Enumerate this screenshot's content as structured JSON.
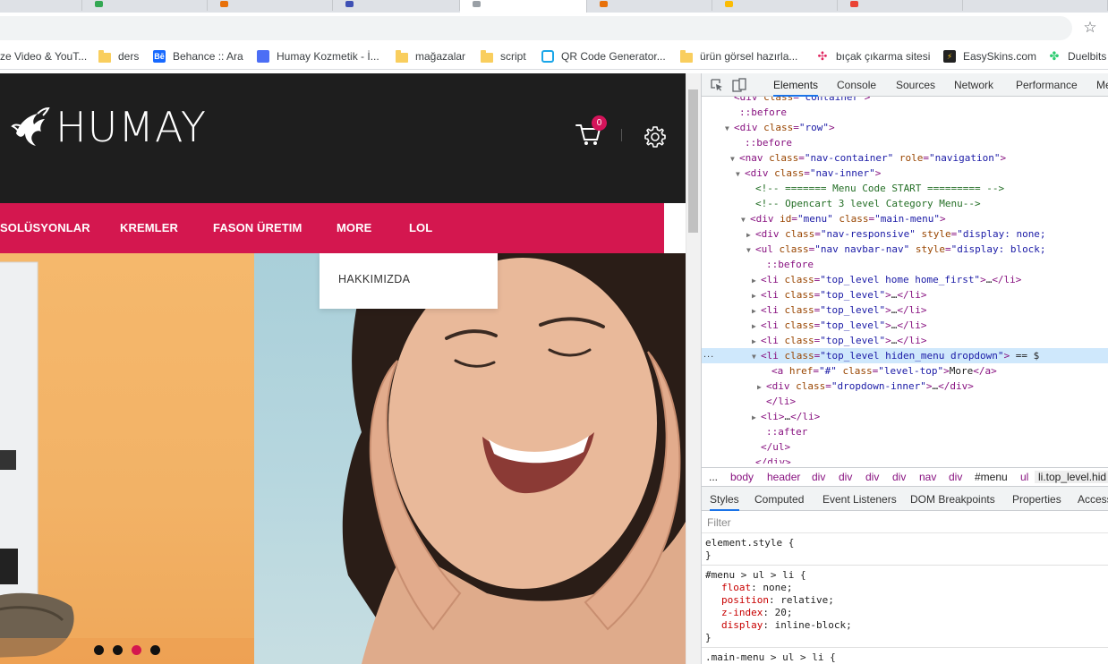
{
  "bookmarks": [
    {
      "label": "ze Video & YouT...",
      "icon": "none"
    },
    {
      "label": "ders",
      "icon": "folder-icon"
    },
    {
      "label": "Behance :: Ara",
      "icon": "behance-icon"
    },
    {
      "label": "Humay Kozmetik - İ...",
      "icon": "site-icon"
    },
    {
      "label": "mağazalar",
      "icon": "folder-icon"
    },
    {
      "label": "script",
      "icon": "folder-icon"
    },
    {
      "label": "QR Code Generator...",
      "icon": "qr-icon"
    },
    {
      "label": "ürün görsel hazırla...",
      "icon": "folder-icon"
    },
    {
      "label": "bıçak çıkarma sitesi",
      "icon": "scissor-icon"
    },
    {
      "label": "EasySkins.com",
      "icon": "easyskins-icon"
    },
    {
      "label": "Duelbits",
      "icon": "duelbits-icon"
    }
  ],
  "site": {
    "logo": "HUMAY",
    "cart_count": "0",
    "nav": [
      "SOLÜSYONLAR",
      "KREMLER",
      "FASON ÜRETIM",
      "MORE",
      "LOL"
    ],
    "dropdown_item": "HAKKIMIZDA"
  },
  "devtools": {
    "tabs": [
      "Elements",
      "Console",
      "Sources",
      "Network",
      "Performance",
      "Me"
    ],
    "dom_lines": [
      {
        "indent": 6,
        "tri": "",
        "html": "<span class='tok-tag'>&lt;div</span> <span class='tok-attr'>class</span>=<span class='tok-val'>\"container\"</span><span class='tok-tag'>&gt;</span>"
      },
      {
        "indent": 7,
        "tri": "",
        "html": "<span class='tok-pseudo'>::before</span>"
      },
      {
        "indent": 6,
        "tri": "▼",
        "html": "<span class='tok-tag'>&lt;div</span> <span class='tok-attr'>class</span>=<span class='tok-val'>\"row\"</span><span class='tok-tag'>&gt;</span>"
      },
      {
        "indent": 8,
        "tri": "",
        "html": "<span class='tok-pseudo'>::before</span>"
      },
      {
        "indent": 7,
        "tri": "▼",
        "html": "<span class='tok-tag'>&lt;nav</span> <span class='tok-attr'>class</span>=<span class='tok-val'>\"nav-container\"</span> <span class='tok-attr'>role</span>=<span class='tok-val'>\"navigation\"</span><span class='tok-tag'>&gt;</span>"
      },
      {
        "indent": 8,
        "tri": "▼",
        "html": "<span class='tok-tag'>&lt;div</span> <span class='tok-attr'>class</span>=<span class='tok-val'>\"nav-inner\"</span><span class='tok-tag'>&gt;</span>"
      },
      {
        "indent": 10,
        "tri": "",
        "html": "<span class='tok-cmt'>&lt;!-- ======= Menu Code START ========= --&gt;</span>"
      },
      {
        "indent": 10,
        "tri": "",
        "html": "<span class='tok-cmt'>&lt;!-- Opencart 3 level Category Menu--&gt;</span>"
      },
      {
        "indent": 9,
        "tri": "▼",
        "html": "<span class='tok-tag'>&lt;div</span> <span class='tok-attr'>id</span>=<span class='tok-val'>\"menu\"</span> <span class='tok-attr'>class</span>=<span class='tok-val'>\"main-menu\"</span><span class='tok-tag'>&gt;</span>"
      },
      {
        "indent": 10,
        "tri": "▶",
        "html": "<span class='tok-tag'>&lt;div</span> <span class='tok-attr'>class</span>=<span class='tok-val'>\"nav-responsive\"</span> <span class='tok-attr'>style</span>=<span class='tok-val'>\"display: none;</span>"
      },
      {
        "indent": 10,
        "tri": "▼",
        "html": "<span class='tok-tag'>&lt;ul</span> <span class='tok-attr'>class</span>=<span class='tok-val'>\"nav navbar-nav\"</span> <span class='tok-attr'>style</span>=<span class='tok-val'>\"display: block;</span>"
      },
      {
        "indent": 12,
        "tri": "",
        "html": "<span class='tok-pseudo'>::before</span>"
      },
      {
        "indent": 11,
        "tri": "▶",
        "html": "<span class='tok-tag'>&lt;li</span> <span class='tok-attr'>class</span>=<span class='tok-val'>\"top_level home home_first\"</span><span class='tok-tag'>&gt;</span><span class='tok-text'>…</span><span class='tok-tag'>&lt;/li&gt;</span>"
      },
      {
        "indent": 11,
        "tri": "▶",
        "html": "<span class='tok-tag'>&lt;li</span> <span class='tok-attr'>class</span>=<span class='tok-val'>\"top_level\"</span><span class='tok-tag'>&gt;</span><span class='tok-text'>…</span><span class='tok-tag'>&lt;/li&gt;</span>"
      },
      {
        "indent": 11,
        "tri": "▶",
        "html": "<span class='tok-tag'>&lt;li</span> <span class='tok-attr'>class</span>=<span class='tok-val'>\"top_level\"</span><span class='tok-tag'>&gt;</span><span class='tok-text'>…</span><span class='tok-tag'>&lt;/li&gt;</span>"
      },
      {
        "indent": 11,
        "tri": "▶",
        "html": "<span class='tok-tag'>&lt;li</span> <span class='tok-attr'>class</span>=<span class='tok-val'>\"top_level\"</span><span class='tok-tag'>&gt;</span><span class='tok-text'>…</span><span class='tok-tag'>&lt;/li&gt;</span>"
      },
      {
        "indent": 11,
        "tri": "▶",
        "html": "<span class='tok-tag'>&lt;li</span> <span class='tok-attr'>class</span>=<span class='tok-val'>\"top_level\"</span><span class='tok-tag'>&gt;</span><span class='tok-text'>…</span><span class='tok-tag'>&lt;/li&gt;</span>"
      },
      {
        "indent": 11,
        "tri": "▼",
        "sel": true,
        "html": "<span class='tok-tag'>&lt;li</span> <span class='tok-attr'>class</span>=<span class='tok-val'>\"top_level hiden_menu dropdown\"</span><span class='tok-tag'>&gt;</span><span class='tok-text'> == $</span>"
      },
      {
        "indent": 13,
        "tri": "",
        "html": "<span class='tok-tag'>&lt;a</span> <span class='tok-attr'>href</span>=<span class='tok-val'>\"#\"</span> <span class='tok-attr'>class</span>=<span class='tok-val'>\"level-top\"</span><span class='tok-tag'>&gt;</span><span class='tok-text'>More</span><span class='tok-tag'>&lt;/a&gt;</span>"
      },
      {
        "indent": 12,
        "tri": "▶",
        "html": "<span class='tok-tag'>&lt;div</span> <span class='tok-attr'>class</span>=<span class='tok-val'>\"dropdown-inner\"</span><span class='tok-tag'>&gt;</span><span class='tok-text'>…</span><span class='tok-tag'>&lt;/div&gt;</span>"
      },
      {
        "indent": 12,
        "tri": "",
        "html": "<span class='tok-tag'>&lt;/li&gt;</span>"
      },
      {
        "indent": 11,
        "tri": "▶",
        "html": "<span class='tok-tag'>&lt;li&gt;</span><span class='tok-text'>…</span><span class='tok-tag'>&lt;/li&gt;</span>"
      },
      {
        "indent": 12,
        "tri": "",
        "html": "<span class='tok-pseudo'>::after</span>"
      },
      {
        "indent": 11,
        "tri": "",
        "html": "<span class='tok-tag'>&lt;/ul&gt;</span>"
      },
      {
        "indent": 10,
        "tri": "",
        "html": "<span class='tok-tag'>&lt;/div&gt;</span>"
      }
    ],
    "dom_ellipsis": "...",
    "breadcrumbs": [
      "...",
      "body",
      "header",
      "div",
      "div",
      "div",
      "div",
      "nav",
      "div",
      "#menu",
      "ul",
      "li.top_level.hid"
    ],
    "sub_tabs": [
      "Styles",
      "Computed",
      "Event Listeners",
      "DOM Breakpoints",
      "Properties",
      "Access"
    ],
    "filter_placeholder": "Filter",
    "styles": {
      "element_selector": "element.style {",
      "element_close": "}",
      "rule_selector": "#menu > ul > li {",
      "rule_props": [
        {
          "prop": "float",
          "val": "none;"
        },
        {
          "prop": "position",
          "val": "relative;"
        },
        {
          "prop": "z-index",
          "val": "20;"
        },
        {
          "prop": "display",
          "val": "inline-block;"
        }
      ],
      "rule_close": "}",
      "next_selector": ".main-menu > ul > li {"
    }
  },
  "colors": {
    "brand_pink": "#d4174f",
    "header_dark": "#1e1e1e",
    "devtools_accent": "#1a73e8"
  }
}
